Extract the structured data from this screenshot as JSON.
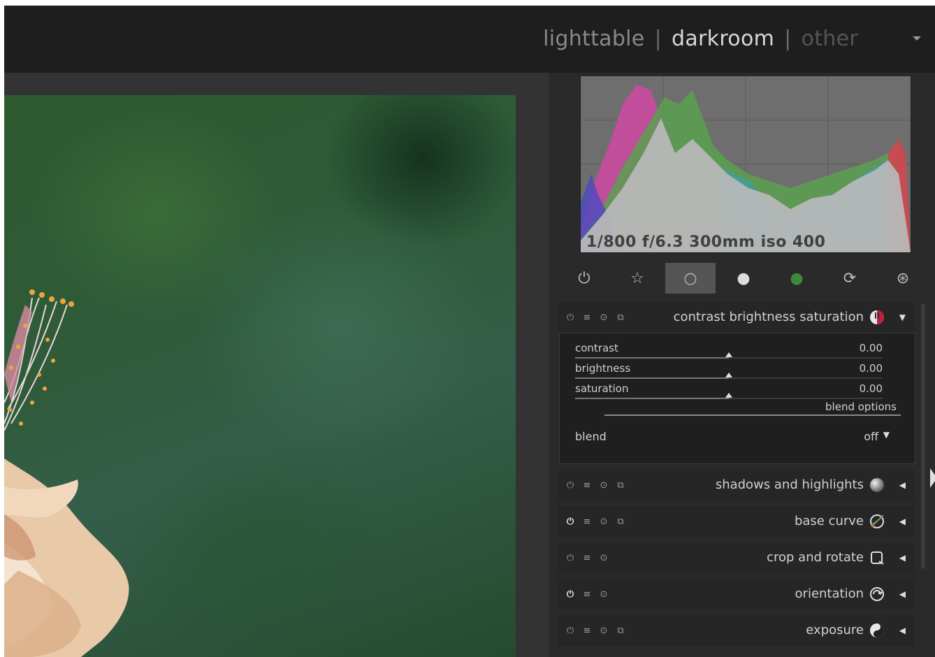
{
  "views": {
    "lighttable": "lighttable",
    "separator": "|",
    "darkroom": "darkroom",
    "other": "other"
  },
  "histogram": {
    "exif": "1/800 f/6.3 300mm iso 400"
  },
  "groups": [
    {
      "name": "active-modules",
      "icon": "power-icon",
      "glyph": "⏻"
    },
    {
      "name": "favorites",
      "icon": "star-icon",
      "glyph": "☆"
    },
    {
      "name": "basic",
      "icon": "circle-icon",
      "glyph": "○"
    },
    {
      "name": "tone",
      "icon": "gray-ball-icon",
      "glyph": "●"
    },
    {
      "name": "color",
      "icon": "color-ball-icon",
      "glyph": "●"
    },
    {
      "name": "correct",
      "icon": "rotate-arrows-icon",
      "glyph": "⟳"
    },
    {
      "name": "effects",
      "icon": "aperture-icon",
      "glyph": "⊛"
    }
  ],
  "flags": {
    "power": "⏻",
    "presets": "≡",
    "reset": "⊙",
    "multi": "⧉"
  },
  "module_expanded": {
    "name": "contrast brightness saturation",
    "sliders": [
      {
        "label": "contrast",
        "value": "0.00"
      },
      {
        "label": "brightness",
        "value": "0.00"
      },
      {
        "label": "saturation",
        "value": "0.00"
      }
    ],
    "blend_options": "blend options",
    "blend_label": "blend",
    "blend_value": "off"
  },
  "modules": [
    {
      "name": "shadows and highlights",
      "on": false,
      "multi": true
    },
    {
      "name": "base curve",
      "on": true,
      "multi": true
    },
    {
      "name": "crop and rotate",
      "on": false,
      "multi": false
    },
    {
      "name": "orientation",
      "on": true,
      "multi": false
    },
    {
      "name": "exposure",
      "on": false,
      "multi": true
    }
  ],
  "colors": {
    "accent": "#555555",
    "panel": "#2a2a2a",
    "topbar": "#1e1e1e"
  }
}
